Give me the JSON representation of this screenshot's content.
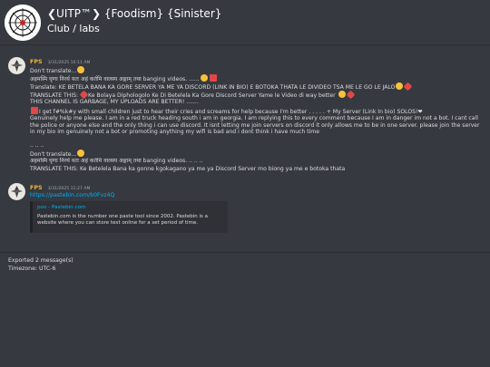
{
  "header": {
    "guild_name": "❮UITP™❯ {Foodism} {Sinister}",
    "channel_name": "Club / labs"
  },
  "messages": [
    {
      "author": "FPS",
      "timestamp": "3/31/2025 10:11 AM",
      "lines": [
        "Don't translate...",
        "अहमस्मि घृणा निरर्थ यतः अहं कर्तमि वालस्य अङ्गाम्‌ तथा banging videos. ......",
        "Translate: KE BETELA BANA KA GORE SERVER YA ME YA DISCORD (LINK IN BIO) E BOTOKA THATA LE DIVIDEO TSA ME LE GO LE JALO",
        "TRANSLATE THIS:",
        "Ke Bolaya Diphologolo Ke Di Betelela Ka Gore Discord Server Yame le Video di way better",
        "THIS CHANNEL IS GARBAGE, MY UPLOADS ARE BETTER! .......",
        "I get f#%k#y with small children just to hear their cries and screams for help because I'm better . . . . . + My Server (Link In bio) SOLOS!❤",
        "Genuinely help me please. I am in a red truck heading south i am in georgia. I am replying this to every comment because I am in danger im not a bot. I cant call the police or anyone else and the only thing i can use discord. It isnt letting me join servers on discord it only allows me to be in one server. please join the server in my bio im genuinely not a bot or promoting anything my wifi is bad and i dont think i have much time",
        ".. .. ..",
        "Don't translate...",
        "अहमस्मि घृणा निरर्थ यतः अहं कर्तमि वालस्य अङ्गाम्‌ तथा banging videos. .. .. ..",
        "TRANSLATE THIS: Ke Betelela Bana ka gonne kgokagano ya me ya Discord Server mo biong ya me e botoka thata"
      ]
    },
    {
      "author": "FPS",
      "timestamp": "3/31/2025 11:27 AM",
      "link": "https://pastebin.com/b0Fvz4Q",
      "embed": {
        "provider": "poo - Pastebin.com",
        "description": "Pastebin.com is the number one paste tool since 2002. Pastebin is a website where you can store text online for a set period of time."
      }
    }
  ],
  "footer": {
    "exported": "Exported 2 message(s)",
    "timezone": "Timezone: UTC-6"
  },
  "colors": {
    "background": "#36393f",
    "author": "#f0b232",
    "link": "#00aff4",
    "embed_bg": "#2f3136"
  }
}
